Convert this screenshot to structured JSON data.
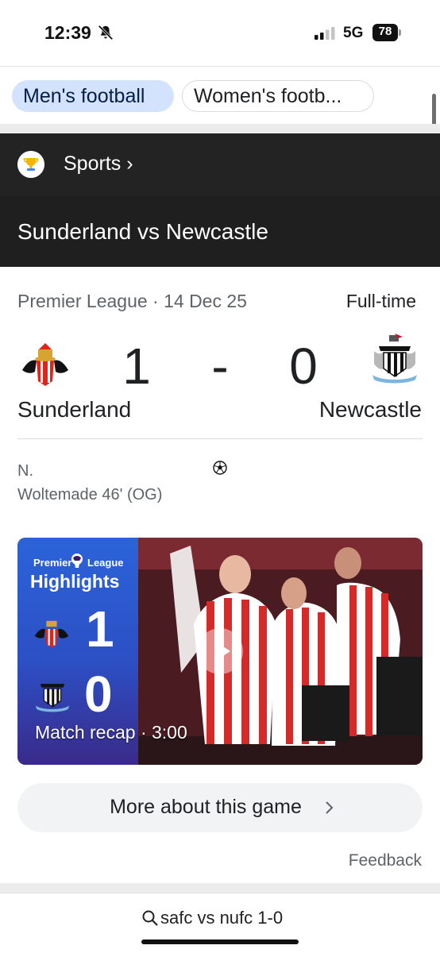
{
  "status_bar": {
    "time": "12:39",
    "network": "5G",
    "battery": "78",
    "icons": [
      "bell-slash-icon",
      "signal-icon",
      "battery-icon"
    ]
  },
  "chips": {
    "active": "Men's football",
    "inactive": "Women's footb..."
  },
  "sports_header": {
    "label": "Sports ›",
    "icon": "trophy-icon"
  },
  "match": {
    "title": "Sunderland vs Newcastle",
    "league_line": "Premier League · 14 Dec 25",
    "status": "Full-time",
    "home_team": "Sunderland",
    "away_team": "Newcastle",
    "home_score": "1",
    "separator": "-",
    "away_score": "0",
    "scorer_name": "N.",
    "scorer_detail": "Woltemade 46' (OG)"
  },
  "video": {
    "brand_1": "Premier",
    "brand_2": "League",
    "highlights": "Highlights",
    "home_score": "1",
    "away_score": "0",
    "caption": "Match recap · 3:00"
  },
  "more_button": {
    "label": "More about this game"
  },
  "feedback": "Feedback",
  "search": {
    "query": "safc vs nufc 1-0"
  },
  "colors": {
    "chip_active": "#d3e3fd",
    "header_dark": "#232323",
    "video_blue": "#2b63d9"
  }
}
